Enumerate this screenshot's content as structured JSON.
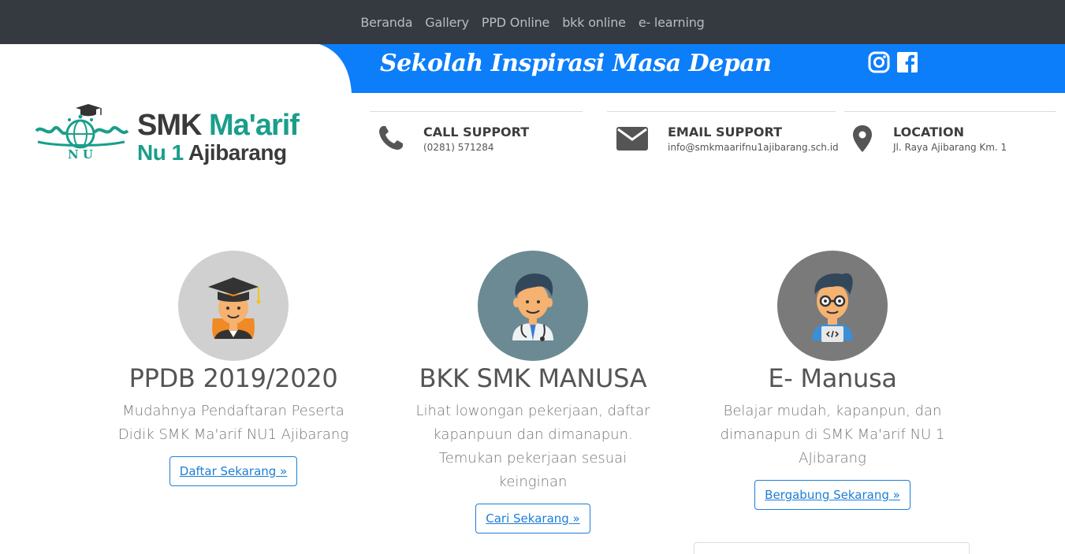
{
  "nav": {
    "items": [
      {
        "label": "Beranda"
      },
      {
        "label": "Gallery"
      },
      {
        "label": "PPD Online"
      },
      {
        "label": "bkk online"
      },
      {
        "label": "e- learning"
      }
    ]
  },
  "banner": {
    "tagline": "Sekolah Inspirasi Masa Depan",
    "color": "#0d7ef9",
    "social": [
      {
        "icon": "instagram-icon"
      },
      {
        "icon": "facebook-icon"
      }
    ]
  },
  "logo": {
    "line1_a": "SMK ",
    "line1_b": "Ma'arif",
    "line2_a": "Nu 1 ",
    "line2_b": "Ajibarang",
    "emblem_text": "N U",
    "accent": "#1a9e8a"
  },
  "contacts": [
    {
      "icon": "phone-icon",
      "title": "CALL SUPPORT",
      "text": "(0281) 571284"
    },
    {
      "icon": "envelope-icon",
      "title": "EMAIL SUPPORT",
      "text": "info@smkmaarifnu1ajibarang.sch.id"
    },
    {
      "icon": "location-pin-icon",
      "title": "LOCATION",
      "text": "Jl. Raya Ajibarang Km. 1"
    }
  ],
  "cards": [
    {
      "avatar": "graduate-avatar",
      "avatar_bg": "#d0d0d0",
      "title": "PPDB 2019/2020",
      "desc": "Mudahnya Pendaftaran Peserta Didik SMK Ma'arif NU1 Ajibarang",
      "button": "Daftar Sekarang »"
    },
    {
      "avatar": "doctor-avatar",
      "avatar_bg": "#6b8a94",
      "title": "BKK SMK MANUSA",
      "desc": "Lihat lowongan pekerjaan, daftar kapanpuun dan dimanapun. Temukan pekerjaan sesuai keinginan",
      "button": "Cari Sekarang »"
    },
    {
      "avatar": "programmer-avatar",
      "avatar_bg": "#7a7a7a",
      "title": "E- Manusa",
      "desc": "Belajar mudah, kapanpun, dan dimanapun di SMK Ma'arif NU 1 AJibarang",
      "button": "Bergabung Sekarang »"
    }
  ]
}
